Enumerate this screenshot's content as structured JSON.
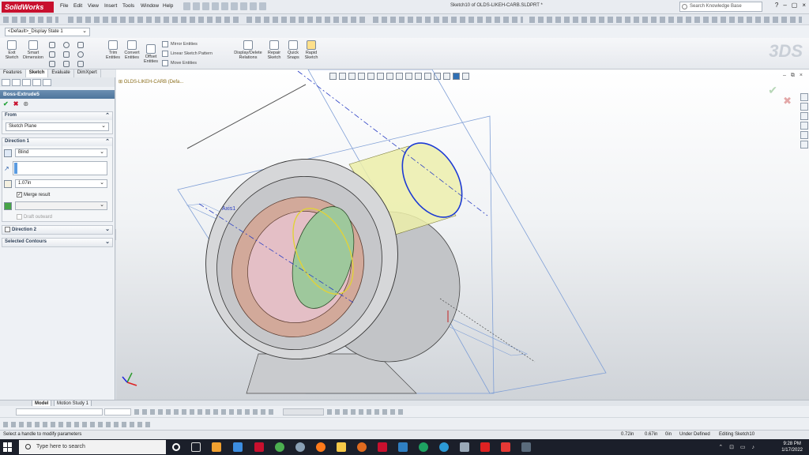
{
  "app": {
    "name": "SolidWorks",
    "document_title": "Sketch10 of OLDS-LIKEH-CARB.SLDPRT *",
    "menu": [
      "File",
      "Edit",
      "View",
      "Insert",
      "Tools",
      "Window",
      "Help"
    ],
    "search_placeholder": "Search Knowledge Base",
    "window_controls": [
      "?",
      "–",
      "▢",
      "×"
    ]
  },
  "config": {
    "display_state": "<Default>_Display State 1"
  },
  "command_manager": {
    "exit_sketch": "Exit Sketch",
    "smart_dimension": "Smart Dimension",
    "trim_entities": "Trim Entities",
    "convert_entities": "Convert Entities",
    "offset_entities": "Offset Entities",
    "mirror_entities": "Mirror Entities",
    "linear_sketch_pattern": "Linear Sketch Pattern",
    "move_entities": "Move Entities",
    "display_delete_relations": "Display/Delete Relations",
    "repair_sketch": "Repair Sketch",
    "quick_snaps": "Quick Snaps",
    "rapid_sketch": "Rapid Sketch",
    "tabs": [
      "Features",
      "Sketch",
      "Evaluate",
      "DimXpert"
    ],
    "active_tab": "Sketch"
  },
  "property_manager": {
    "title": "Boss-Extrude5",
    "from": {
      "header": "From",
      "value": "Sketch Plane"
    },
    "direction1": {
      "header": "Direction 1",
      "end_condition": "Blind",
      "depth": "1.07in",
      "merge_result_label": "Merge result",
      "merge_result_checked": true,
      "draft_outward_label": "Draft outward"
    },
    "direction2": {
      "header": "Direction 2",
      "checked": false
    },
    "selected_contours": {
      "header": "Selected Contours"
    }
  },
  "viewport": {
    "feature_tree_root": "OLDS-LIKEH-CARB  (Defa...",
    "axis_label": "Axis1"
  },
  "model_tabs": [
    "Model",
    "Motion Study 1"
  ],
  "active_model_tab": "Model",
  "status_bar": {
    "message": "Select a handle to modify parameters",
    "x": "0.72in",
    "y": "0.67in",
    "z": "0in",
    "state": "Under Defined",
    "editing": "Editing Sketch10"
  },
  "taskbar": {
    "search_placeholder": "Type here to search",
    "time": "9:28 PM",
    "date": "1/17/2022"
  }
}
